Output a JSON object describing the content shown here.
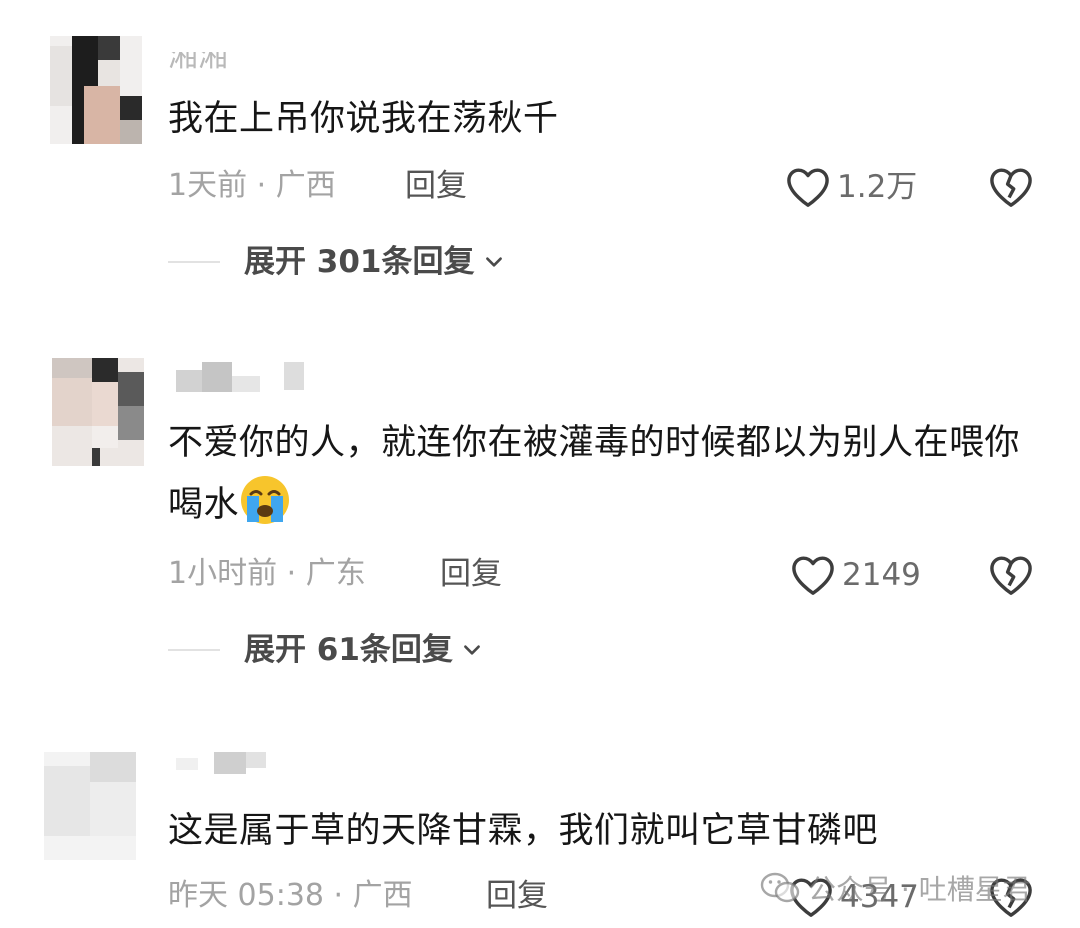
{
  "comments": [
    {
      "username": "湘湘",
      "text": "我在上吊你说我在荡秋千",
      "time_location": "1天前 · 广西",
      "reply_label": "回复",
      "like_count": "1.2万",
      "expand_label": "展开 301条回复"
    },
    {
      "username": "",
      "text": "不爱你的人，就连你在被灌毒的时候都以为别人在喂你喝水",
      "emoji": "loudly-crying-face",
      "time_location": "1小时前 · 广东",
      "reply_label": "回复",
      "like_count": "2149",
      "expand_label": "展开 61条回复"
    },
    {
      "username": "",
      "text": "这是属于草的天降甘霖，我们就叫它草甘磷吧",
      "time_location": "昨天 05:38 · 广西",
      "reply_label": "回复",
      "like_count": "4347"
    }
  ],
  "watermark": {
    "icon": "wechat-icon",
    "text": "公众号 · 吐槽星君"
  },
  "icons": {
    "like": "heart-outline-icon",
    "dislike": "broken-heart-icon",
    "expand": "chevron-down-icon"
  }
}
